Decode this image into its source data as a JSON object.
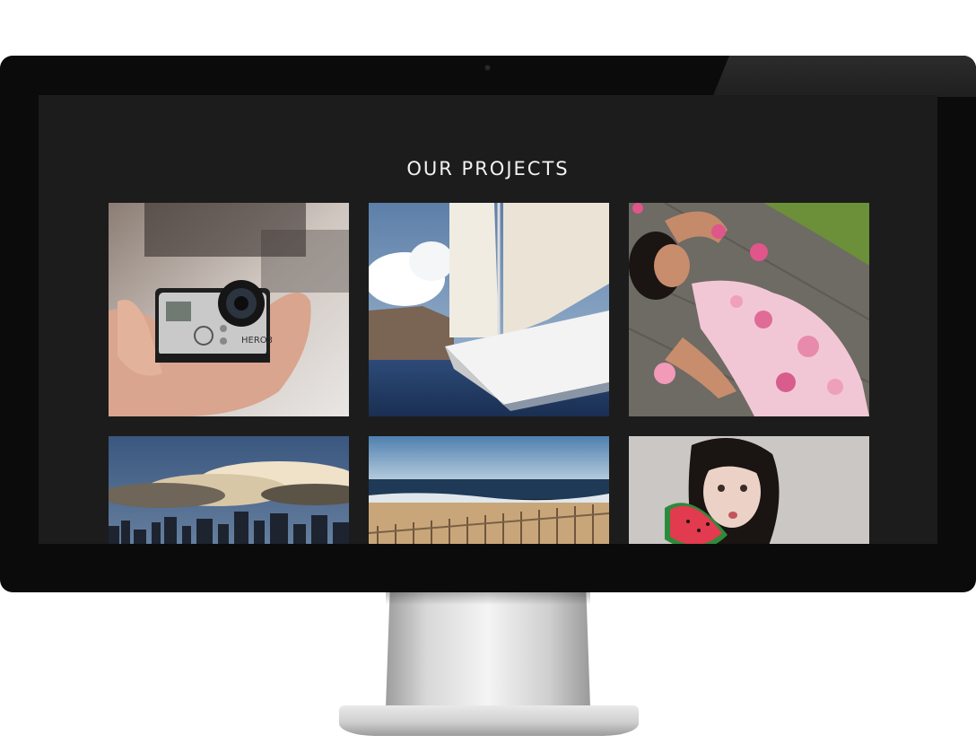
{
  "page": {
    "section_title": "OUR PROJECTS"
  },
  "projects": [
    {
      "subject": "action camera in hand",
      "camera_label": "HERO3"
    },
    {
      "subject": "sailboat at sea"
    },
    {
      "subject": "woman in floral dress lying on deck"
    },
    {
      "subject": "city skyline under clouds"
    },
    {
      "subject": "beach with wooden fence"
    },
    {
      "subject": "woman holding watermelon slice"
    }
  ],
  "colors": {
    "screen_bg": "#1c1c1c",
    "bezel": "#0b0b0b",
    "title_text": "#f2f2f2"
  }
}
